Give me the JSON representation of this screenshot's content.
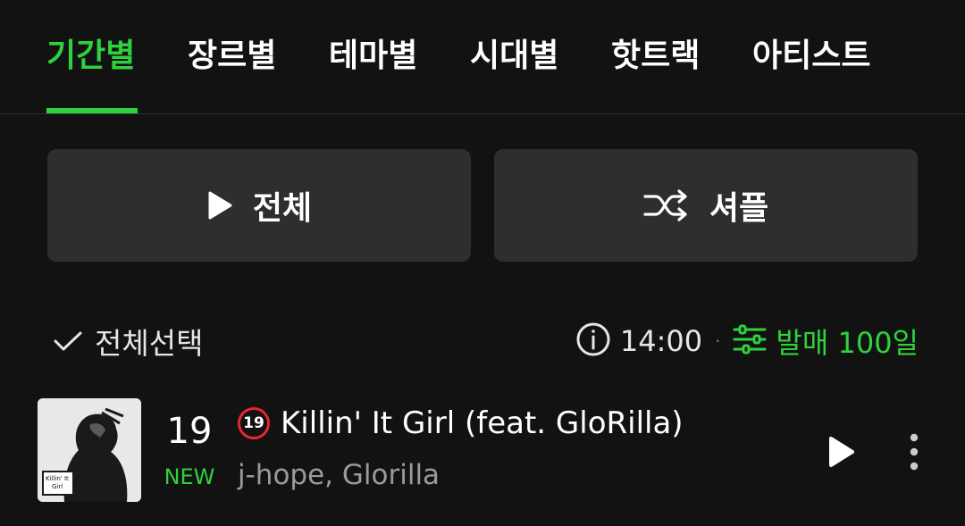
{
  "tabs": [
    {
      "label": "기간별",
      "active": true
    },
    {
      "label": "장르별"
    },
    {
      "label": "테마별"
    },
    {
      "label": "시대별"
    },
    {
      "label": "핫트랙"
    },
    {
      "label": "아티스트"
    }
  ],
  "actions": {
    "play_all_label": "전체",
    "shuffle_label": "셔플"
  },
  "toolbar": {
    "select_all_label": "전체선택",
    "update_time": "14:00",
    "separator": "·",
    "filter_label": "발매 100일"
  },
  "tracks": [
    {
      "rank": "19",
      "status": "NEW",
      "age_rating": "19",
      "title": "Killin' It Girl (feat. GloRilla)",
      "artist": "j-hope, Glorilla",
      "cover_text": [
        "Killin' It",
        "Girl"
      ]
    }
  ],
  "colors": {
    "accent": "#2fd13c",
    "background": "#121212",
    "button_bg": "#2e2e2e",
    "age_badge": "#e4282d"
  },
  "icons": {
    "play_all": "play-icon",
    "shuffle": "shuffle-icon",
    "select_all": "check-icon",
    "info": "info-icon",
    "filter": "sliders-icon",
    "track_play": "play-icon",
    "track_more": "more-vertical-icon"
  }
}
